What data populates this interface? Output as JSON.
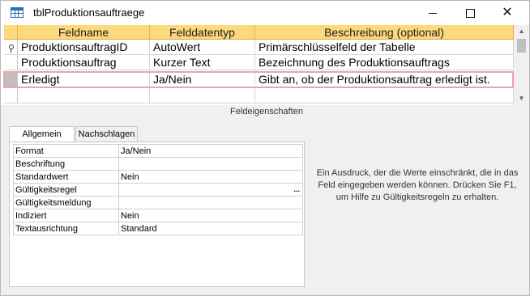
{
  "window": {
    "title": "tblProduktionsauftraege",
    "buttons": {
      "minimize": "—",
      "maximize": "☐",
      "close": "✕"
    }
  },
  "table": {
    "headers": [
      "Feldname",
      "Felddatentyp",
      "Beschreibung (optional)"
    ],
    "rows": [
      {
        "feldname": "ProduktionsauftragID",
        "typ": "AutoWert",
        "beschreibung": "Primärschlüsselfeld der Tabelle",
        "primary_key": true
      },
      {
        "feldname": "Produktionsauftrag",
        "typ": "Kurzer Text",
        "beschreibung": "Bezeichnung des Produktionsauftrags",
        "primary_key": false
      },
      {
        "feldname": "Erledigt",
        "typ": "Ja/Nein",
        "beschreibung": "Gibt an, ob der Produktionsauftrag erledigt ist.",
        "primary_key": false,
        "selected": true
      }
    ]
  },
  "field_properties": {
    "section_label": "Feldeigenschaften",
    "tabs": [
      "Allgemein",
      "Nachschlagen"
    ],
    "active_tab": "Allgemein",
    "properties": [
      {
        "name": "Format",
        "value": "Ja/Nein"
      },
      {
        "name": "Beschriftung",
        "value": ""
      },
      {
        "name": "Standardwert",
        "value": "Nein"
      },
      {
        "name": "Gültigkeitsregel",
        "value": ""
      },
      {
        "name": "Gültigkeitsmeldung",
        "value": ""
      },
      {
        "name": "Indiziert",
        "value": "Nein"
      },
      {
        "name": "Textausrichtung",
        "value": "Standard"
      }
    ],
    "builder_button": "...",
    "help_text": "Ein Ausdruck, der die Werte einschränkt, die in das Feld eingegeben werden können. Drücken Sie F1, um Hilfe zu Gültigkeitsregeln zu erhalten."
  },
  "colors": {
    "header_bg": "#fcd97a",
    "active_row_border": "#eaa7a9",
    "row_selector_active": "#bfbfbf",
    "table_icon": "#2e6db4"
  }
}
